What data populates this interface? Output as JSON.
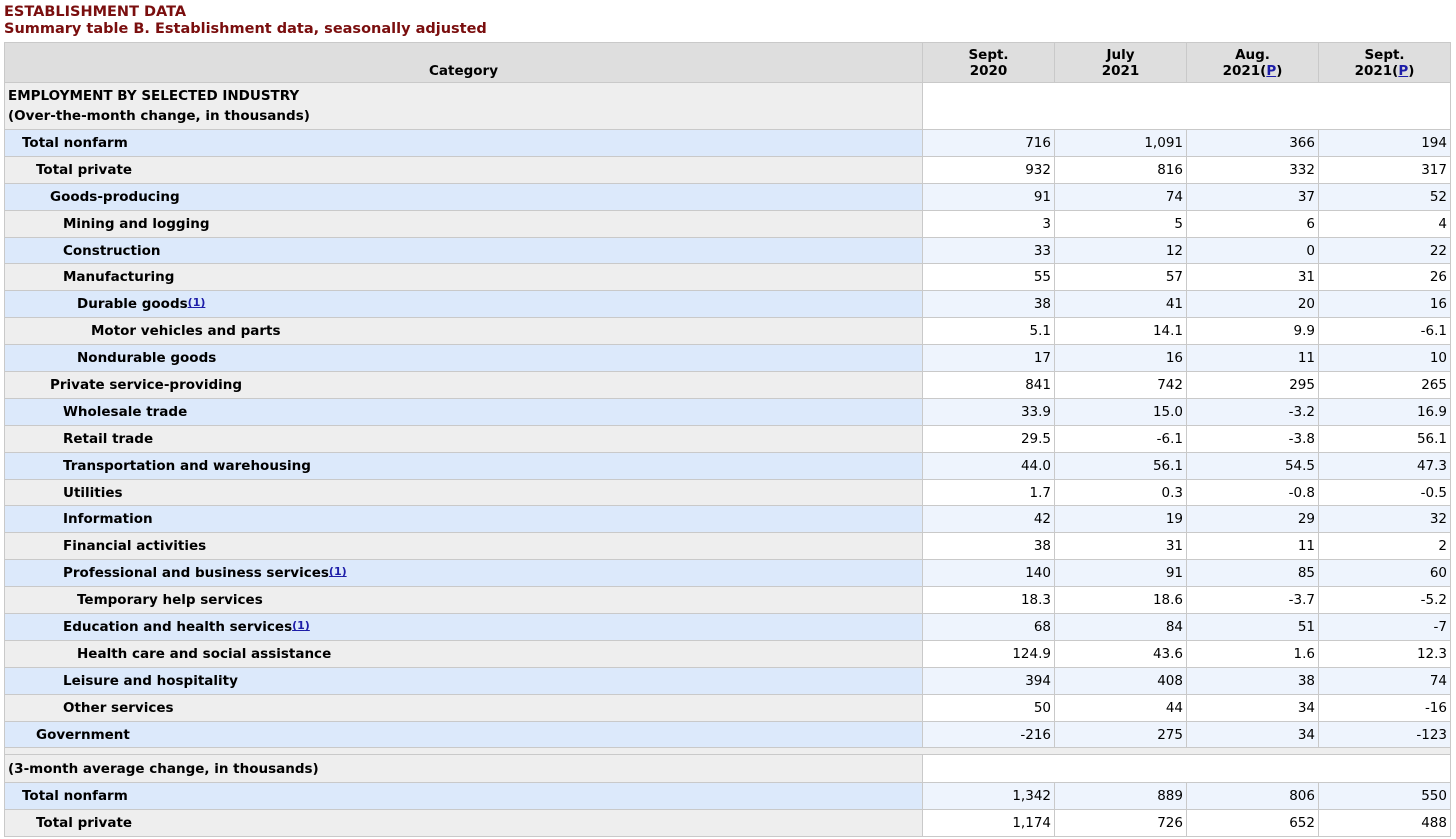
{
  "heading": {
    "title": "ESTABLISHMENT DATA",
    "subtitle": "Summary table B. Establishment data, seasonally adjusted"
  },
  "columns": {
    "category": "Category",
    "c1": {
      "line1": "Sept.",
      "line2": "2020",
      "flag": ""
    },
    "c2": {
      "line1": "July",
      "line2": "2021",
      "flag": ""
    },
    "c3": {
      "line1": "Aug.",
      "line2": "2021",
      "flag": "P"
    },
    "c4": {
      "line1": "Sept.",
      "line2": "2021",
      "flag": "P"
    }
  },
  "section1": {
    "line1": "EMPLOYMENT BY SELECTED INDUSTRY",
    "line2": "(Over-the-month change, in thousands)"
  },
  "rows": [
    {
      "label": "Total nonfarm",
      "fn": "",
      "values": [
        "716",
        "1,091",
        "366",
        "194"
      ]
    },
    {
      "label": "Total private",
      "fn": "",
      "values": [
        "932",
        "816",
        "332",
        "317"
      ]
    },
    {
      "label": "Goods-producing",
      "fn": "",
      "values": [
        "91",
        "74",
        "37",
        "52"
      ]
    },
    {
      "label": "Mining and logging",
      "fn": "",
      "values": [
        "3",
        "5",
        "6",
        "4"
      ]
    },
    {
      "label": "Construction",
      "fn": "",
      "values": [
        "33",
        "12",
        "0",
        "22"
      ]
    },
    {
      "label": "Manufacturing",
      "fn": "",
      "values": [
        "55",
        "57",
        "31",
        "26"
      ]
    },
    {
      "label": "Durable goods",
      "fn": "1",
      "values": [
        "38",
        "41",
        "20",
        "16"
      ]
    },
    {
      "label": "Motor vehicles and parts",
      "fn": "",
      "values": [
        "5.1",
        "14.1",
        "9.9",
        "-6.1"
      ]
    },
    {
      "label": "Nondurable goods",
      "fn": "",
      "values": [
        "17",
        "16",
        "11",
        "10"
      ]
    },
    {
      "label": "Private service-providing",
      "fn": "",
      "values": [
        "841",
        "742",
        "295",
        "265"
      ]
    },
    {
      "label": "Wholesale trade",
      "fn": "",
      "values": [
        "33.9",
        "15.0",
        "-3.2",
        "16.9"
      ]
    },
    {
      "label": "Retail trade",
      "fn": "",
      "values": [
        "29.5",
        "-6.1",
        "-3.8",
        "56.1"
      ]
    },
    {
      "label": "Transportation and warehousing",
      "fn": "",
      "values": [
        "44.0",
        "56.1",
        "54.5",
        "47.3"
      ]
    },
    {
      "label": "Utilities",
      "fn": "",
      "values": [
        "1.7",
        "0.3",
        "-0.8",
        "-0.5"
      ]
    },
    {
      "label": "Information",
      "fn": "",
      "values": [
        "42",
        "19",
        "29",
        "32"
      ]
    },
    {
      "label": "Financial activities",
      "fn": "",
      "values": [
        "38",
        "31",
        "11",
        "2"
      ]
    },
    {
      "label": "Professional and business services",
      "fn": "1",
      "values": [
        "140",
        "91",
        "85",
        "60"
      ]
    },
    {
      "label": "Temporary help services",
      "fn": "",
      "values": [
        "18.3",
        "18.6",
        "-3.7",
        "-5.2"
      ]
    },
    {
      "label": "Education and health services",
      "fn": "1",
      "values": [
        "68",
        "84",
        "51",
        "-7"
      ]
    },
    {
      "label": "Health care and social assistance",
      "fn": "",
      "values": [
        "124.9",
        "43.6",
        "1.6",
        "12.3"
      ]
    },
    {
      "label": "Leisure and hospitality",
      "fn": "",
      "values": [
        "394",
        "408",
        "38",
        "74"
      ]
    },
    {
      "label": "Other services",
      "fn": "",
      "values": [
        "50",
        "44",
        "34",
        "-16"
      ]
    },
    {
      "label": "Government",
      "fn": "",
      "values": [
        "-216",
        "275",
        "34",
        "-123"
      ]
    }
  ],
  "section2": {
    "line1": "(3-month average change, in thousands)"
  },
  "rows2": [
    {
      "label": "Total nonfarm",
      "fn": "",
      "values": [
        "1,342",
        "889",
        "806",
        "550"
      ]
    },
    {
      "label": "Total private",
      "fn": "",
      "values": [
        "1,174",
        "726",
        "652",
        "488"
      ]
    }
  ],
  "colors": {
    "title": "#7a0e0e",
    "odd_row": "#dce9fb",
    "even_row": "#eeeeee",
    "link": "#1d1da8"
  }
}
